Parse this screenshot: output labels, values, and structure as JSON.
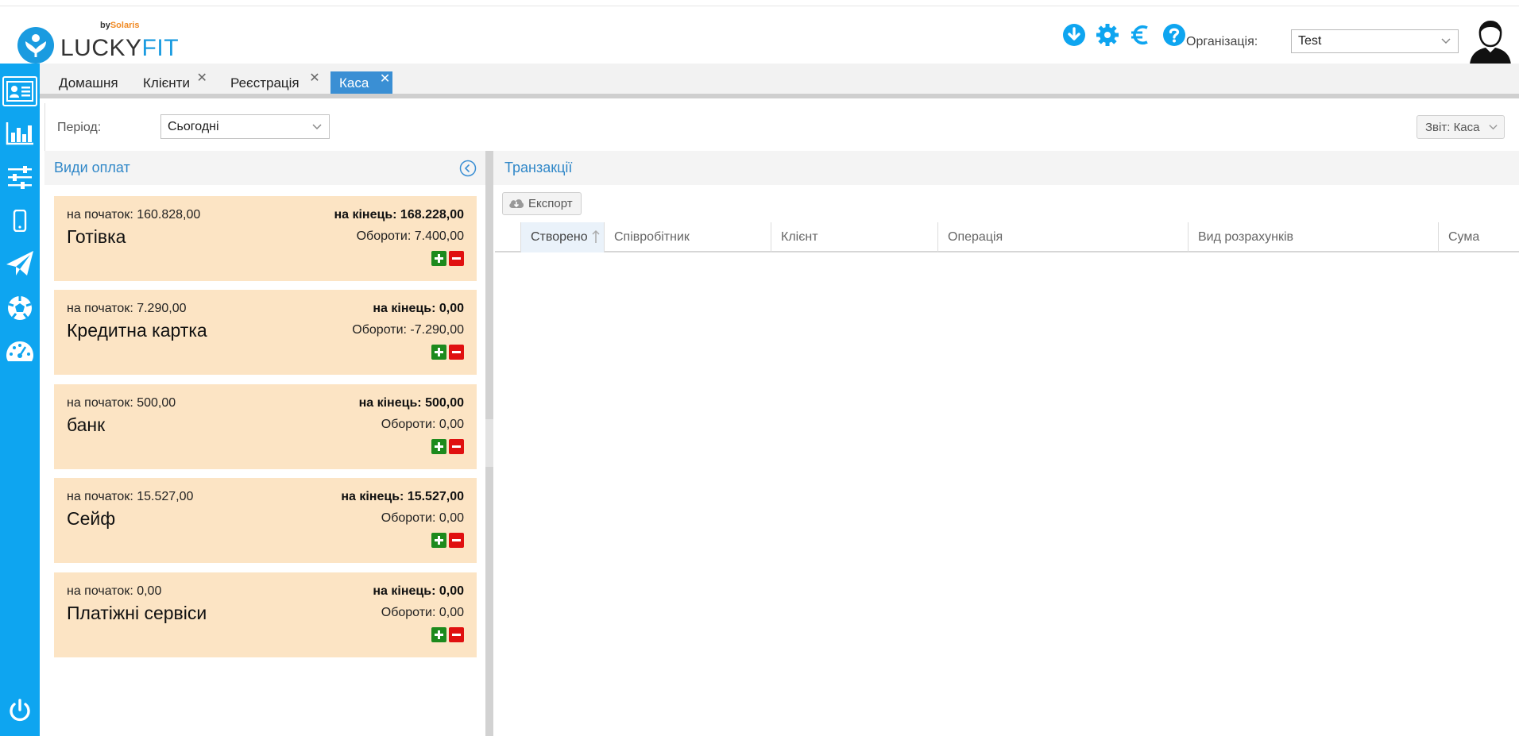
{
  "header": {
    "logo": {
      "by": "by",
      "brand_by": "Solaris",
      "name_part1": "LUCKY",
      "name_part2": "FIT"
    },
    "icons": [
      "download-icon",
      "gear-icon",
      "euro-icon",
      "help-icon"
    ],
    "org_label": "Організація:",
    "org_value": "Test"
  },
  "sidebar": {
    "items": [
      "client-card-icon",
      "bar-chart-icon",
      "sliders-icon",
      "mobile-icon",
      "paper-plane-icon",
      "ball-icon",
      "dashboard-icon"
    ],
    "bottom": "power-icon"
  },
  "tabs": [
    {
      "label": "Домашня",
      "closable": false,
      "active": false
    },
    {
      "label": "Клієнти",
      "closable": true,
      "active": false
    },
    {
      "label": "Реєстрація",
      "closable": true,
      "active": false
    },
    {
      "label": "Каса",
      "closable": true,
      "active": true
    }
  ],
  "filters": {
    "period_label": "Період:",
    "period_value": "Сьогодні",
    "report_label": "Звіт: Каса"
  },
  "payments": {
    "title": "Види оплат",
    "cards": [
      {
        "start": "на початок: 160.828,00",
        "name": "Готівка",
        "end": "на кінець: 168.228,00",
        "turnover": "Обороти: 7.400,00"
      },
      {
        "start": "на початок: 7.290,00",
        "name": "Кредитна картка",
        "end": "на кінець: 0,00",
        "turnover": "Обороти: -7.290,00"
      },
      {
        "start": "на початок: 500,00",
        "name": "банк",
        "end": "на кінець: 500,00",
        "turnover": "Обороти: 0,00"
      },
      {
        "start": "на початок: 15.527,00",
        "name": "Сейф",
        "end": "на кінець: 15.527,00",
        "turnover": "Обороти: 0,00"
      },
      {
        "start": "на початок: 0,00",
        "name": "Платіжні сервіси",
        "end": "на кінець: 0,00",
        "turnover": "Обороти: 0,00"
      }
    ]
  },
  "transactions": {
    "title": "Транзакції",
    "export_label": "Експорт",
    "columns": [
      "Створено",
      "Співробітник",
      "Клієнт",
      "Операція",
      "Вид розрахунків",
      "Сума"
    ]
  },
  "colors": {
    "accent": "#0ea5f0",
    "title_blue": "#2f87c8",
    "card_bg": "#fce4c4",
    "plus": "#1d8a1d",
    "minus": "#e01010"
  }
}
